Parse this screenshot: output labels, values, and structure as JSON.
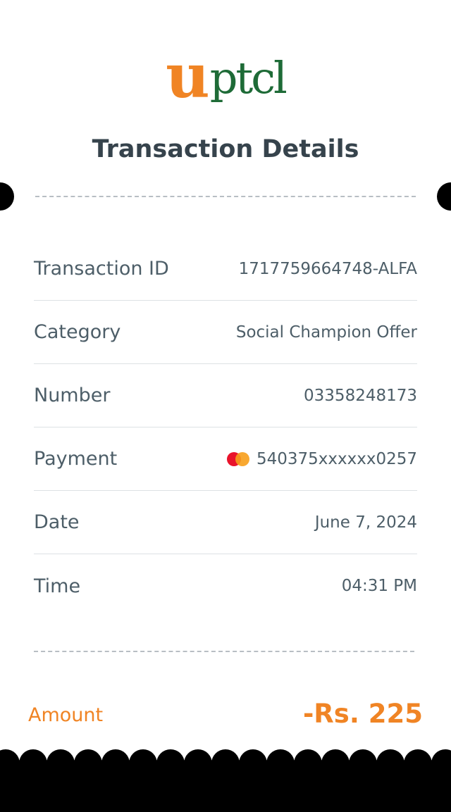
{
  "logo": {
    "prefix": "u",
    "brand": "ptcl"
  },
  "title": "Transaction Details",
  "details": [
    {
      "label": "Transaction ID",
      "value": "1717759664748-ALFA"
    },
    {
      "label": "Category",
      "value": "Social Champion Offer"
    },
    {
      "label": "Number",
      "value": "03358248173"
    },
    {
      "label": "Payment",
      "value": "540375xxxxxx0257",
      "icon": "mastercard-icon"
    },
    {
      "label": "Date",
      "value": "June 7, 2024"
    },
    {
      "label": "Time",
      "value": "04:31 PM"
    }
  ],
  "amount": {
    "label": "Amount",
    "value": "-Rs. 225"
  },
  "colors": {
    "accent": "#f08424",
    "brand_green": "#1e6b37",
    "text": "#4d5e68",
    "title": "#36434c"
  }
}
